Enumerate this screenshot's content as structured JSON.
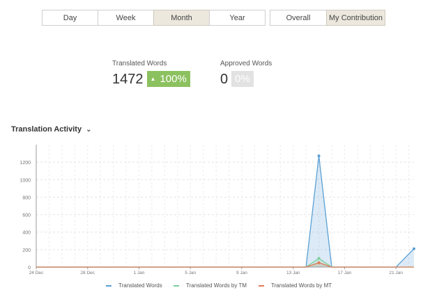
{
  "range_tabs": [
    {
      "label": "Day",
      "active": false
    },
    {
      "label": "Week",
      "active": false
    },
    {
      "label": "Month",
      "active": true
    },
    {
      "label": "Year",
      "active": false
    }
  ],
  "scope_tabs": [
    {
      "label": "Overall",
      "active": false
    },
    {
      "label": "My Contribution",
      "active": true
    }
  ],
  "stats": {
    "translated": {
      "label": "Translated Words",
      "value": "1472",
      "pct": "100%",
      "arrow": "▲"
    },
    "approved": {
      "label": "Approved Words",
      "value": "0",
      "pct": "0%"
    }
  },
  "section": {
    "title": "Translation Activity",
    "chevron": "chevron-down-icon"
  },
  "chart_data": {
    "type": "area",
    "x_tick_labels": [
      "24 Dec",
      "28 Dec",
      "1 Jan",
      "5 Jan",
      "9 Jan",
      "13 Jan",
      "17 Jan",
      "21 Jan"
    ],
    "x_days": [
      0,
      4,
      8,
      12,
      16,
      20,
      24,
      28
    ],
    "y_ticks": [
      "0",
      "200",
      "400",
      "600",
      "800",
      "1000",
      "1200"
    ],
    "ylim": [
      0,
      1400
    ],
    "xlim": [
      0,
      29.4
    ],
    "series": [
      {
        "name": "Translated Words",
        "color": "#5aa0d5",
        "points": [
          [
            0,
            0
          ],
          [
            20,
            0
          ],
          [
            21,
            0
          ],
          [
            22,
            1272
          ],
          [
            23,
            0
          ],
          [
            28,
            0
          ],
          [
            29.4,
            210
          ]
        ]
      },
      {
        "name": "Translated Words by TM",
        "color": "#7ccf9a",
        "points": [
          [
            0,
            0
          ],
          [
            20,
            0
          ],
          [
            21,
            0
          ],
          [
            22,
            100
          ],
          [
            23,
            0
          ],
          [
            28,
            0
          ],
          [
            29.4,
            0
          ]
        ]
      },
      {
        "name": "Translated Words by MT",
        "color": "#e07b55",
        "points": [
          [
            0,
            0
          ],
          [
            20,
            0
          ],
          [
            21,
            0
          ],
          [
            22,
            50
          ],
          [
            23,
            0
          ],
          [
            28,
            0
          ],
          [
            29.4,
            0
          ]
        ]
      }
    ],
    "grid": true
  },
  "colors": {
    "accent_active": "#ece8de",
    "badge_green": "#8cc15f",
    "badge_grey": "#e2e2e2"
  }
}
